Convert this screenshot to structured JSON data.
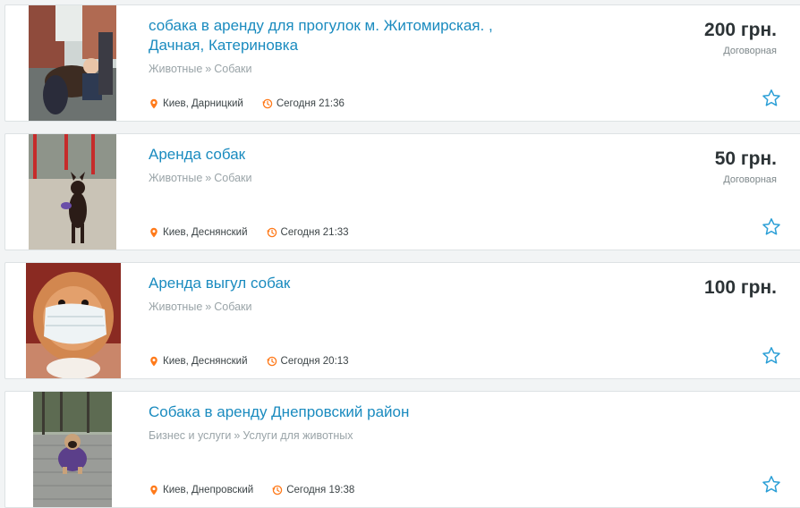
{
  "colors": {
    "title_link": "#1a8bbf",
    "category_text": "#9aa4a8",
    "meta_icon": "#ff7a1a",
    "star_outline": "#2b9fd6",
    "price_text": "#2c3336"
  },
  "listings": [
    {
      "title": "собака в аренду для прогулок м. Житомирская. , Дачная, Катериновка",
      "category": {
        "parent": "Животные",
        "separator": "»",
        "child": "Собаки"
      },
      "location": "Киев, Дарницкий",
      "time": "Сегодня 21:36",
      "price": "200 грн.",
      "price_note": "Договорная",
      "location_icon": "map-pin-icon",
      "time_icon": "clock-icon",
      "favorite_icon": "star-outline-icon"
    },
    {
      "title": "Аренда собак",
      "category": {
        "parent": "Животные",
        "separator": "»",
        "child": "Собаки"
      },
      "location": "Киев, Деснянский",
      "time": "Сегодня 21:33",
      "price": "50 грн.",
      "price_note": "Договорная",
      "location_icon": "map-pin-icon",
      "time_icon": "clock-icon",
      "favorite_icon": "star-outline-icon"
    },
    {
      "title": "Аренда выгул собак",
      "category": {
        "parent": "Животные",
        "separator": "»",
        "child": "Собаки"
      },
      "location": "Киев, Деснянский",
      "time": "Сегодня 20:13",
      "price": "100 грн.",
      "price_note": "",
      "location_icon": "map-pin-icon",
      "time_icon": "clock-icon",
      "favorite_icon": "star-outline-icon"
    },
    {
      "title": "Собака в аренду Днепровский район",
      "category": {
        "parent": "Бизнес и услуги",
        "separator": "»",
        "child": "Услуги для животных"
      },
      "location": "Киев, Днепровский",
      "time": "Сегодня 19:38",
      "price": "",
      "price_note": "",
      "location_icon": "map-pin-icon",
      "time_icon": "clock-icon",
      "favorite_icon": "star-outline-icon"
    }
  ]
}
